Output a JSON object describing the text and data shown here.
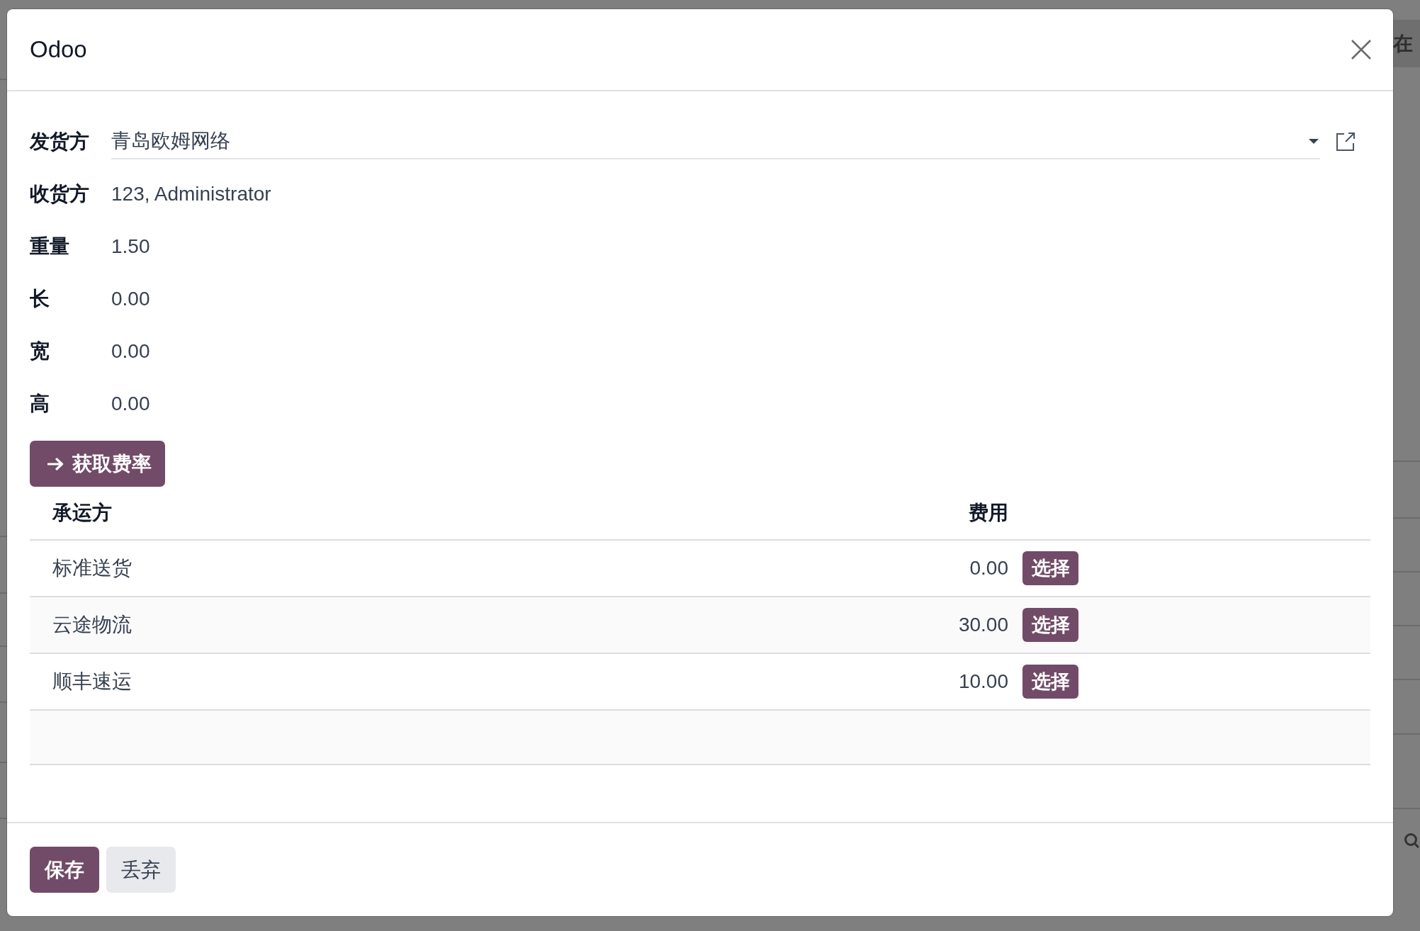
{
  "background": {
    "toolbar_text": "在"
  },
  "dialog": {
    "title": "Odoo",
    "fields": [
      {
        "label": "发货方",
        "value": "青岛欧姆网络",
        "kind": "select"
      },
      {
        "label": "收货方",
        "value": "123, Administrator",
        "kind": "readonly"
      },
      {
        "label": "重量",
        "value": "1.50",
        "kind": "readonly"
      },
      {
        "label": "长",
        "value": "0.00",
        "kind": "readonly"
      },
      {
        "label": "宽",
        "value": "0.00",
        "kind": "readonly"
      },
      {
        "label": "高",
        "value": "0.00",
        "kind": "readonly"
      }
    ],
    "action_button": "获取费率",
    "table": {
      "columns": [
        "承运方",
        "费用"
      ],
      "rows": [
        {
          "carrier": "标准送货",
          "cost": "0.00",
          "button": "选择"
        },
        {
          "carrier": "云途物流",
          "cost": "30.00",
          "button": "选择"
        },
        {
          "carrier": "顺丰速运",
          "cost": "10.00",
          "button": "选择"
        }
      ]
    },
    "footer_buttons": [
      {
        "label": "保存",
        "kind": "primary"
      },
      {
        "label": "丢弃",
        "kind": "secondary"
      }
    ]
  }
}
